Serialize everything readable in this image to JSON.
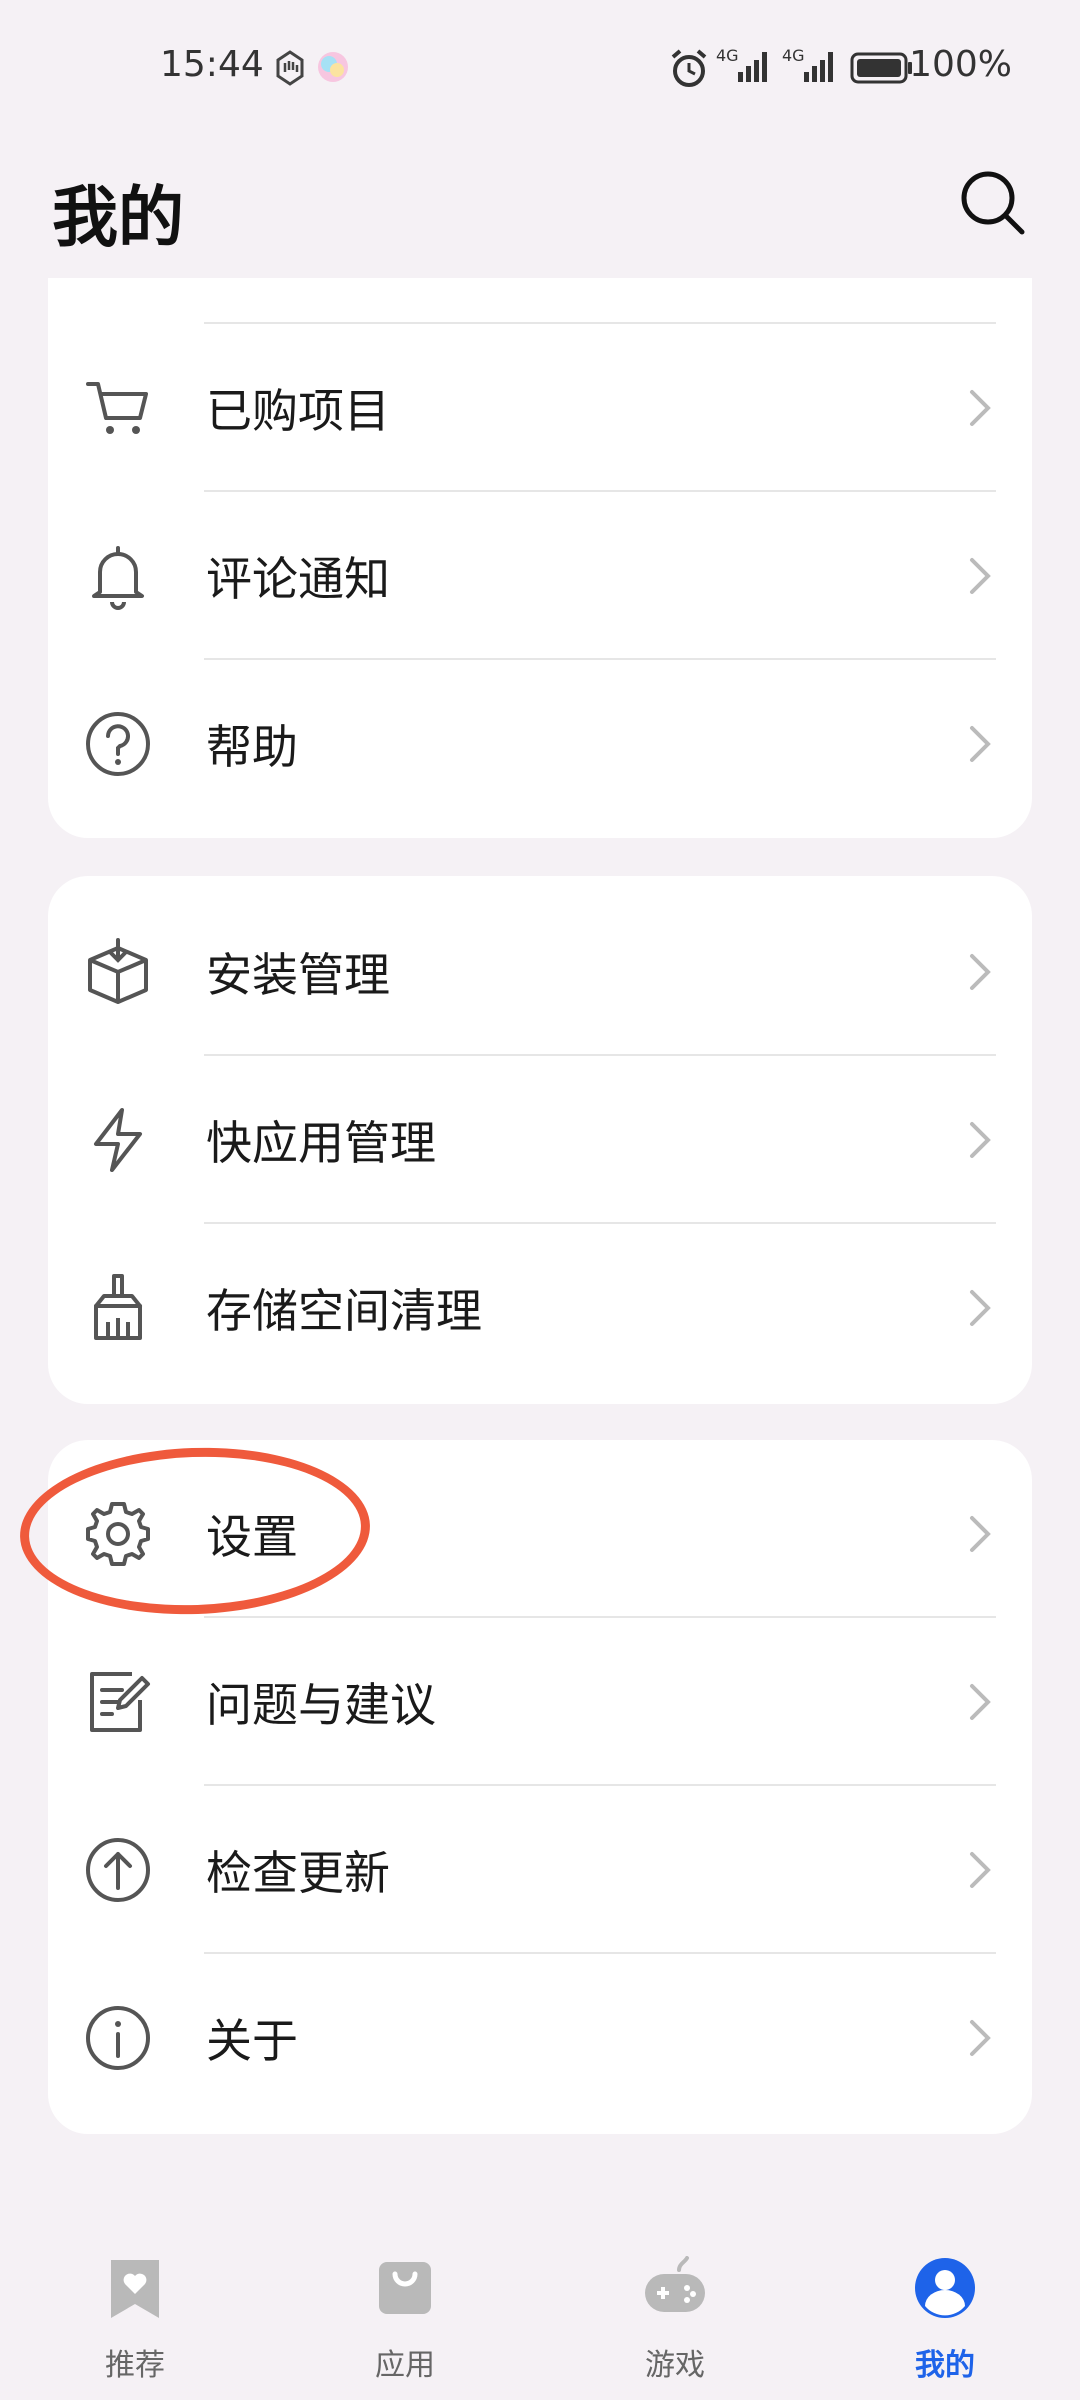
{
  "status": {
    "time": "15:44",
    "net1": "4G",
    "net2": "4G",
    "battery": "100%"
  },
  "header": {
    "title": "我的"
  },
  "cards": [
    {
      "items": [
        {
          "label": "已购项目",
          "icon": "cart-icon"
        },
        {
          "label": "评论通知",
          "icon": "bell-icon"
        },
        {
          "label": "帮助",
          "icon": "help-icon"
        }
      ]
    },
    {
      "items": [
        {
          "label": "安装管理",
          "icon": "package-icon"
        },
        {
          "label": "快应用管理",
          "icon": "lightning-icon"
        },
        {
          "label": "存储空间清理",
          "icon": "broom-icon"
        }
      ]
    },
    {
      "items": [
        {
          "label": "设置",
          "icon": "gear-icon"
        },
        {
          "label": "问题与建议",
          "icon": "feedback-icon"
        },
        {
          "label": "检查更新",
          "icon": "upload-icon"
        },
        {
          "label": "关于",
          "icon": "info-icon"
        }
      ]
    }
  ],
  "nav": [
    {
      "label": "推荐",
      "icon": "recommend-icon"
    },
    {
      "label": "应用",
      "icon": "apps-icon"
    },
    {
      "label": "游戏",
      "icon": "gamepad-icon"
    },
    {
      "label": "我的",
      "icon": "profile-icon",
      "active": true
    }
  ],
  "colors": {
    "accent": "#1e63e9",
    "annotation": "#ef5a3c",
    "background": "#f5f1f5"
  }
}
